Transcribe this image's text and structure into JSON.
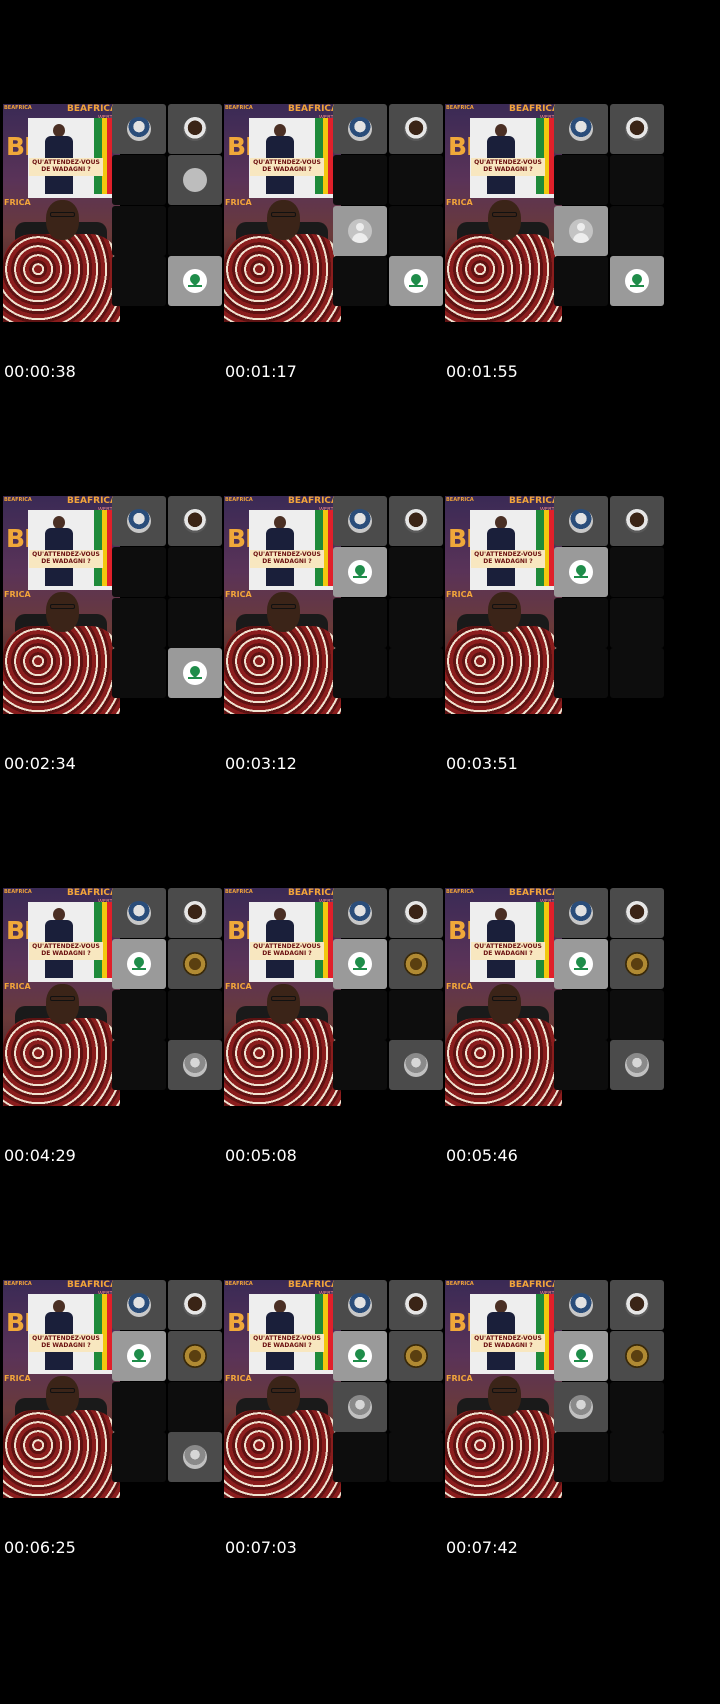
{
  "backdrop": {
    "brand": "BEAFRICA",
    "brand_small": "BEAFRICA",
    "big_text": "BE",
    "side_text": "FRICA",
    "webtv": "WEBTV",
    "headline": "QU'ATTENDEZ-VOUS DE WADAGNI ?"
  },
  "frames": [
    {
      "timestamp": "00:00:38",
      "tiles": [
        "photo",
        "man",
        "dark",
        "grey",
        "dark",
        "dark",
        "dark",
        "edu"
      ]
    },
    {
      "timestamp": "00:01:17",
      "tiles": [
        "photo",
        "man",
        "dark",
        "dark",
        "default",
        "dark",
        "dark",
        "edu"
      ]
    },
    {
      "timestamp": "00:01:55",
      "tiles": [
        "photo",
        "man",
        "dark",
        "dark",
        "default",
        "dark",
        "dark",
        "edu"
      ]
    },
    {
      "timestamp": "00:02:34",
      "tiles": [
        "photo",
        "man",
        "dark",
        "dark",
        "dark",
        "dark",
        "dark",
        "edu"
      ]
    },
    {
      "timestamp": "00:03:12",
      "tiles": [
        "photo",
        "man",
        "edu",
        "dark",
        "dark",
        "dark",
        "dark",
        "dark"
      ]
    },
    {
      "timestamp": "00:03:51",
      "tiles": [
        "photo",
        "man",
        "edu",
        "dark",
        "dark",
        "dark",
        "dark",
        "dark"
      ]
    },
    {
      "timestamp": "00:04:29",
      "tiles": [
        "photo",
        "man",
        "edu",
        "gold",
        "dark",
        "dark",
        "dark",
        "person"
      ]
    },
    {
      "timestamp": "00:05:08",
      "tiles": [
        "photo",
        "man",
        "edu",
        "gold",
        "dark",
        "dark",
        "dark",
        "person"
      ]
    },
    {
      "timestamp": "00:05:46",
      "tiles": [
        "photo",
        "man",
        "edu",
        "gold",
        "dark",
        "dark",
        "dark",
        "person"
      ]
    },
    {
      "timestamp": "00:06:25",
      "tiles": [
        "photo",
        "man",
        "edu",
        "gold",
        "dark",
        "dark",
        "dark",
        "person"
      ]
    },
    {
      "timestamp": "00:07:03",
      "tiles": [
        "photo",
        "man",
        "edu",
        "gold",
        "person",
        "dark",
        "dark",
        "dark"
      ]
    },
    {
      "timestamp": "00:07:42",
      "tiles": [
        "photo",
        "man",
        "edu",
        "gold",
        "person",
        "dark",
        "dark",
        "dark"
      ]
    }
  ]
}
